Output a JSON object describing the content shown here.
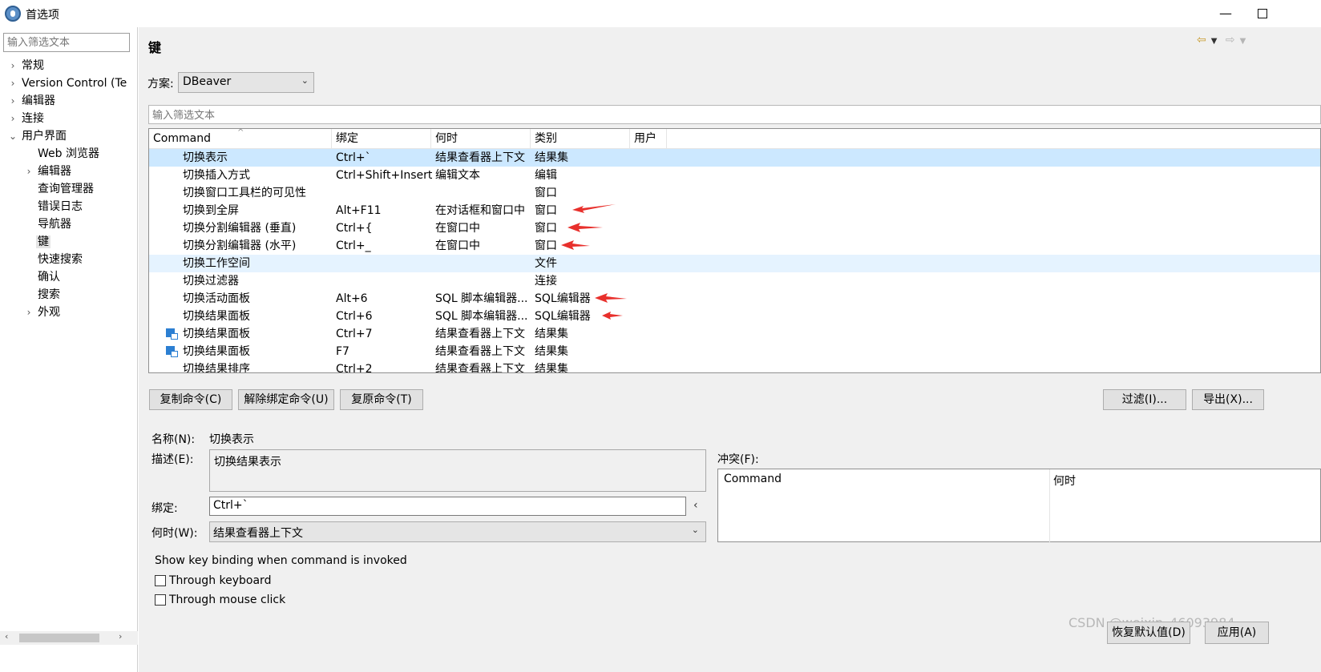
{
  "window": {
    "title": "首选项",
    "minimize_icon": "minimize-icon",
    "maximize_icon": "maximize-icon"
  },
  "nav": {
    "filter_placeholder": "输入筛选文本",
    "items": [
      {
        "label": "常规",
        "expandable": true
      },
      {
        "label": "Version Control (Te",
        "expandable": true
      },
      {
        "label": "编辑器",
        "expandable": true
      },
      {
        "label": "连接",
        "expandable": true
      },
      {
        "label": "用户界面",
        "expandable": true,
        "expanded": true
      },
      {
        "label": "Web 浏览器"
      },
      {
        "label": "编辑器",
        "expandable": true
      },
      {
        "label": "查询管理器"
      },
      {
        "label": "错误日志"
      },
      {
        "label": "导航器"
      },
      {
        "label": "键",
        "selected": true
      },
      {
        "label": "快速搜索"
      },
      {
        "label": "确认"
      },
      {
        "label": "搜索"
      },
      {
        "label": "外观",
        "expandable": true
      }
    ]
  },
  "page": {
    "title": "键"
  },
  "scheme": {
    "label": "方案:",
    "value": "DBeaver"
  },
  "command_filter": {
    "placeholder": "输入筛选文本"
  },
  "table": {
    "columns": [
      "Command",
      "绑定",
      "何时",
      "类别",
      "用户"
    ],
    "rows": [
      {
        "command": "切换表示",
        "binding": "Ctrl+`",
        "when": "结果查看器上下文",
        "category": "结果集",
        "state": "selected"
      },
      {
        "command": "切换插入方式",
        "binding": "Ctrl+Shift+Insert",
        "when": "编辑文本",
        "category": "编辑"
      },
      {
        "command": "切换窗口工具栏的可见性",
        "binding": "",
        "when": "",
        "category": "窗口"
      },
      {
        "command": "切换到全屏",
        "binding": "Alt+F11",
        "when": "在对话框和窗口中",
        "category": "窗口",
        "arrow": true
      },
      {
        "command": "切换分割编辑器 (垂直)",
        "binding": "Ctrl+{",
        "when": "在窗口中",
        "category": "窗口",
        "arrow": true
      },
      {
        "command": "切换分割编辑器 (水平)",
        "binding": "Ctrl+_",
        "when": "在窗口中",
        "category": "窗口",
        "arrow": true
      },
      {
        "command": "切换工作空间",
        "binding": "",
        "when": "",
        "category": "文件",
        "state": "hover"
      },
      {
        "command": "切换过滤器",
        "binding": "",
        "when": "",
        "category": "连接"
      },
      {
        "command": "切换活动面板",
        "binding": "Alt+6",
        "when": "SQL 脚本编辑器...",
        "category": "SQL编辑器",
        "arrow": true
      },
      {
        "command": "切换结果面板",
        "binding": "Ctrl+6",
        "when": "SQL 脚本编辑器...",
        "category": "SQL编辑器",
        "arrow": true
      },
      {
        "command": "切换结果面板",
        "binding": "Ctrl+7",
        "when": "结果查看器上下文",
        "category": "结果集",
        "icon": "panel-icon"
      },
      {
        "command": "切换结果面板",
        "binding": "F7",
        "when": "结果查看器上下文",
        "category": "结果集",
        "icon": "panel-icon"
      },
      {
        "command": "切换结果排序",
        "binding": "Ctrl+2",
        "when": "结果查看器上下文",
        "category": "结果集"
      }
    ]
  },
  "buttons": {
    "copy": "复制命令(C)",
    "unbind": "解除绑定命令(U)",
    "restore": "复原命令(T)",
    "filter": "过滤(I)...",
    "export": "导出(X)..."
  },
  "details": {
    "name_label": "名称(N):",
    "name_value": "切换表示",
    "desc_label": "描述(E):",
    "desc_value": "切换结果表示",
    "binding_label": "绑定:",
    "binding_value": "Ctrl+`",
    "when_label": "何时(W):",
    "when_value": "结果查看器上下文",
    "conflict_label": "冲突(F):",
    "conflict_columns": [
      "Command",
      "何时"
    ]
  },
  "show_binding": {
    "title": "Show key binding when command is invoked",
    "through_keyboard": "Through keyboard",
    "through_mouse": "Through mouse click"
  },
  "footer": {
    "restore_defaults": "恢复默认值(D)",
    "apply": "应用(A)",
    "watermark": "CSDN @weixin_46093984"
  },
  "colors": {
    "selection": "#cce8ff",
    "hover": "#e5f3ff",
    "annotation_arrow": "#e8302c"
  }
}
